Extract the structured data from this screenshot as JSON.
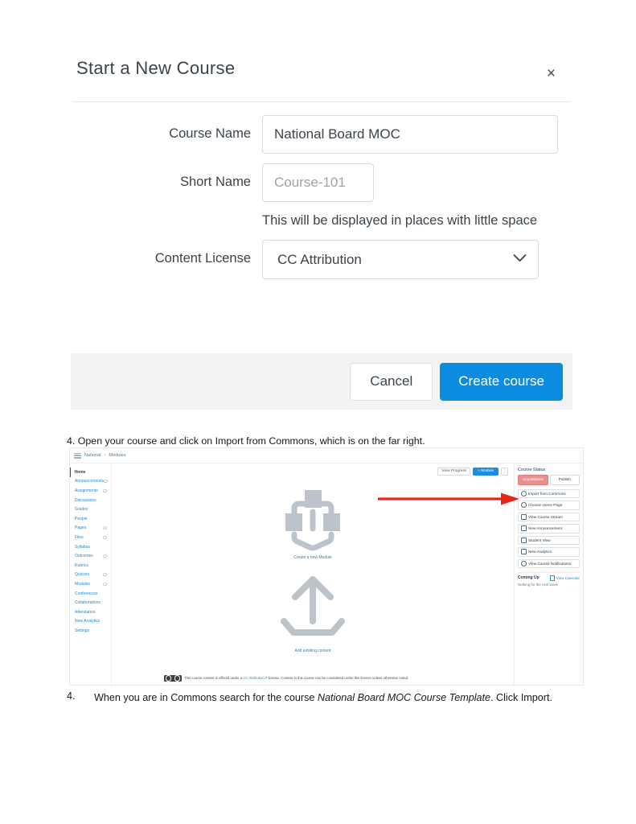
{
  "dialog": {
    "title": "Start a New Course",
    "close_label": "×",
    "fields": [
      {
        "label": "Course Name",
        "value": "National Board MOC",
        "placeholder": "",
        "hint": ""
      },
      {
        "label": "Short Name",
        "value": "",
        "placeholder": "Course-101",
        "hint": "This will be displayed in places with little space"
      }
    ],
    "license": {
      "label": "Content License",
      "selected": "CC Attribution"
    },
    "footer": {
      "cancel_label": "Cancel",
      "create_label": "Create course"
    }
  },
  "steps": {
    "top": "4. Open your course and click on Import from Commons, which is on the far right.",
    "bottom": {
      "number": "4.",
      "before_italic": "When you are in Commons search for the course ",
      "italic": "National Board MOC Course Template",
      "after_italic": ". Click Import."
    }
  },
  "canvas": {
    "breadcrumb": {
      "course": "National",
      "separator": "›",
      "page": "Modules"
    },
    "nav_items": [
      {
        "label": "Home",
        "eye": false,
        "active": true
      },
      {
        "label": "Announcements",
        "eye": true,
        "active": false
      },
      {
        "label": "Assignments",
        "eye": true,
        "active": false
      },
      {
        "label": "Discussions",
        "eye": false,
        "active": false
      },
      {
        "label": "Grades",
        "eye": false,
        "active": false
      },
      {
        "label": "People",
        "eye": false,
        "active": false
      },
      {
        "label": "Pages",
        "eye": true,
        "active": false
      },
      {
        "label": "Files",
        "eye": true,
        "active": false
      },
      {
        "label": "Syllabus",
        "eye": false,
        "active": false
      },
      {
        "label": "Outcomes",
        "eye": true,
        "active": false
      },
      {
        "label": "Rubrics",
        "eye": false,
        "active": false
      },
      {
        "label": "Quizzes",
        "eye": true,
        "active": false
      },
      {
        "label": "Modules",
        "eye": true,
        "active": false
      },
      {
        "label": "Conferences",
        "eye": false,
        "active": false
      },
      {
        "label": "Collaborations",
        "eye": false,
        "active": false
      },
      {
        "label": "Attendance",
        "eye": false,
        "active": false
      },
      {
        "label": "New Analytics",
        "eye": false,
        "active": false
      },
      {
        "label": "Settings",
        "eye": false,
        "active": false
      }
    ],
    "toolbar": {
      "view_progress": "View Progress",
      "add_module": "+ Module",
      "kebab": "⋮"
    },
    "empty_state": {
      "create_module_label": "Create a new Module",
      "add_existing_label": "Add existing content"
    },
    "license_footer": {
      "before_link": "This course content is offered under a ",
      "link": "CC Attribution",
      "after_link": " license. Content in this course can be considered under this license unless otherwise noted."
    },
    "status": {
      "title": "Course Status",
      "unpublished_label": "Unpublished",
      "publish_label": "Publish",
      "actions": [
        {
          "label": "Import from Commons",
          "icon": "globe-icon"
        },
        {
          "label": "Choose Home Page",
          "icon": "home-icon"
        },
        {
          "label": "View Course Stream",
          "icon": "stream-icon"
        },
        {
          "label": "New Announcement",
          "icon": "announcement-icon"
        },
        {
          "label": "Student View",
          "icon": "eye-icon"
        },
        {
          "label": "New Analytics",
          "icon": "analytics-icon"
        },
        {
          "label": "View Course Notifications",
          "icon": "bell-icon"
        }
      ],
      "coming_up_title": "Coming Up",
      "view_calendar_label": "View Calendar",
      "nothing_text": "Nothing for the next week"
    }
  },
  "colors": {
    "primary_blue": "#0c8ce1",
    "canvas_link_blue": "#1c8bd4",
    "unpublished_red": "#eb8e8e",
    "arrow_red": "#e8251b",
    "footer_gray": "#f2f3f3"
  }
}
